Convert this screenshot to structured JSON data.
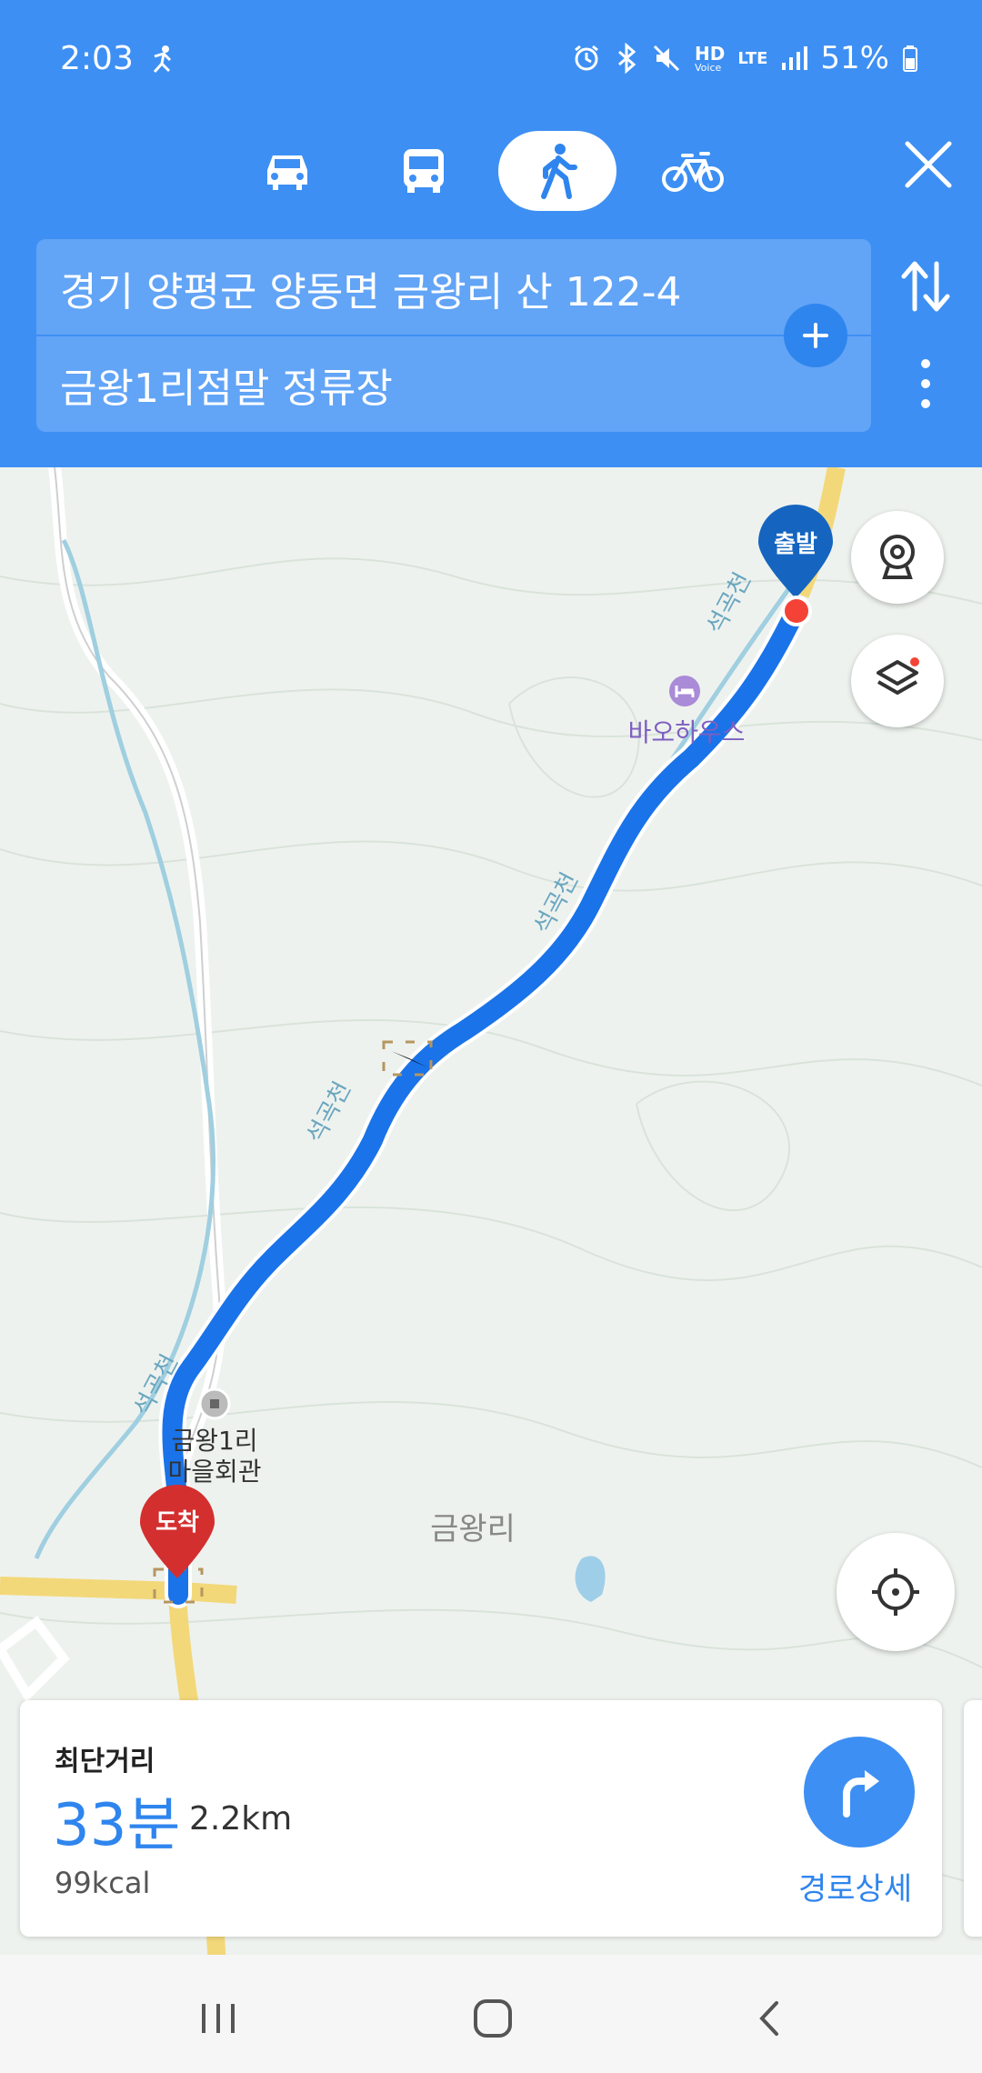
{
  "status_bar": {
    "time": "2:03",
    "network": "HD",
    "network_sub": "Voice",
    "lte": "LTE",
    "battery": "51%"
  },
  "transport_modes": [
    {
      "name": "car",
      "icon": "car-icon",
      "active": false
    },
    {
      "name": "transit",
      "icon": "bus-icon",
      "active": false
    },
    {
      "name": "walk",
      "icon": "walk-icon",
      "active": true
    },
    {
      "name": "bike",
      "icon": "bike-icon",
      "active": false
    }
  ],
  "route_fields": {
    "origin": "경기 양평군 양동면 금왕리 산 122-4",
    "destination": "금왕1리점말 정류장"
  },
  "map": {
    "start_label": "출발",
    "end_label": "도착",
    "poi_1": "바오하우스",
    "poi_2_line1": "금왕1리",
    "poi_2_line2": "마을회관",
    "area_label": "금왕리",
    "stream_1": "석곡천",
    "stream_2": "석곡천",
    "stream_3": "석곡천",
    "stream_4": "석곡천",
    "route_color": "#1a73e8",
    "start_pin_color": "#1565c0",
    "end_pin_color": "#d32f2f"
  },
  "summary": {
    "route_type": "최단거리",
    "duration": "33분",
    "distance": "2.2km",
    "calories": "99kcal",
    "detail_label": "경로상세"
  }
}
